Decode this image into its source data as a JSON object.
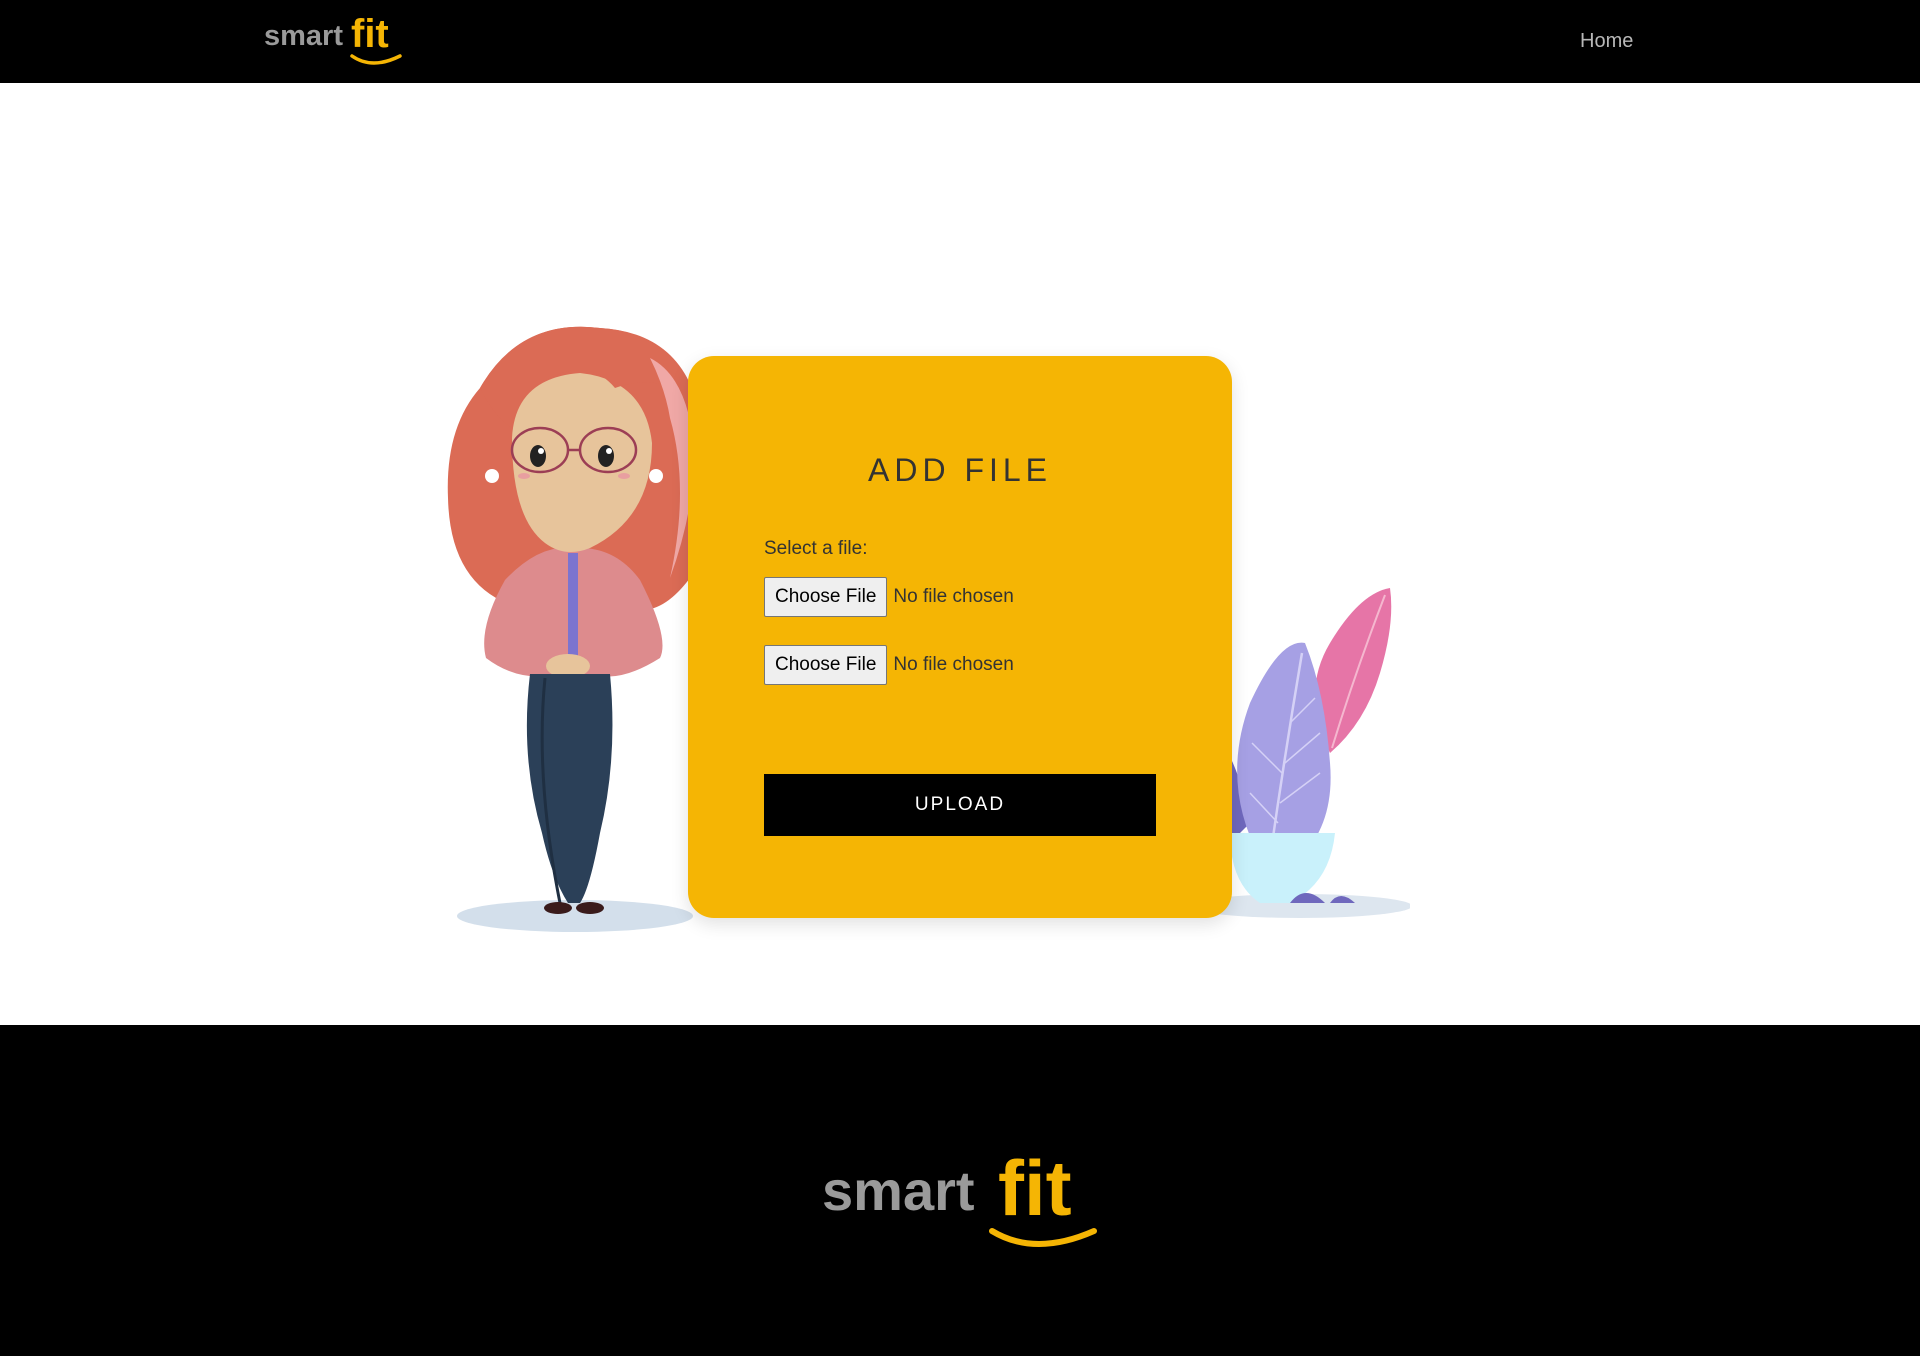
{
  "header": {
    "logo": {
      "word1": "smart",
      "word2": "fit"
    },
    "nav": {
      "home_label": "Home"
    }
  },
  "card": {
    "title": "ADD FILE",
    "select_label": "Select a file:",
    "file_inputs": [
      {
        "button_label": "Choose File",
        "status": "No file chosen"
      },
      {
        "button_label": "Choose File",
        "status": "No file chosen"
      }
    ],
    "upload_label": "UPLOAD"
  },
  "footer": {
    "logo": {
      "word1": "smart",
      "word2": "fit"
    }
  },
  "colors": {
    "brand_yellow": "#f5b504",
    "header_bg": "#000000",
    "logo_grey": "#9a9a9a"
  },
  "icons": {
    "woman": "woman-illustration",
    "plant": "plant-illustration"
  }
}
